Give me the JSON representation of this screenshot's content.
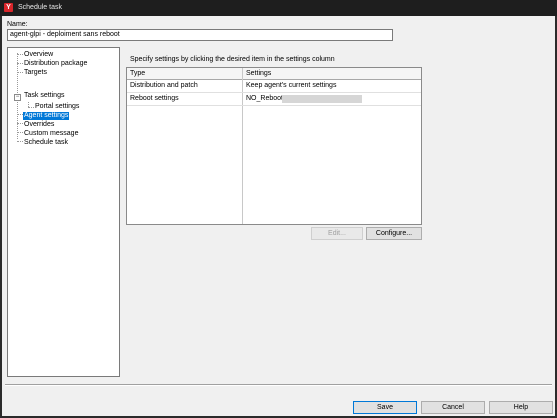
{
  "window": {
    "title": "Schedule task",
    "app_icon": "y-app-icon"
  },
  "name_field": {
    "label": "Name:",
    "value": "agent-glpi - deploiment sans reboot"
  },
  "tree": {
    "items": [
      {
        "label": "Overview"
      },
      {
        "label": "Distribution package"
      },
      {
        "label": "Targets"
      },
      {
        "label": "Task settings",
        "expanded": true
      },
      {
        "label": "Portal settings"
      },
      {
        "label": "Agent settings",
        "selected": true
      },
      {
        "label": "Overrides"
      },
      {
        "label": "Custom message"
      },
      {
        "label": "Schedule task"
      }
    ],
    "expander_symbol": "−"
  },
  "settings": {
    "instruction": "Specify settings by clicking the desired item in the settings column",
    "columns": [
      "Type",
      "Settings"
    ],
    "rows": [
      {
        "type": "Distribution and patch",
        "setting": "Keep agent's current settings"
      },
      {
        "type": "Reboot settings",
        "setting": "NO_Reboot"
      }
    ]
  },
  "buttons": {
    "edit": "Edit...",
    "configure": "Configure...",
    "save": "Save",
    "cancel": "Cancel",
    "help": "Help"
  },
  "colors": {
    "selection": "#0078d7",
    "brand": "#d9262b"
  }
}
